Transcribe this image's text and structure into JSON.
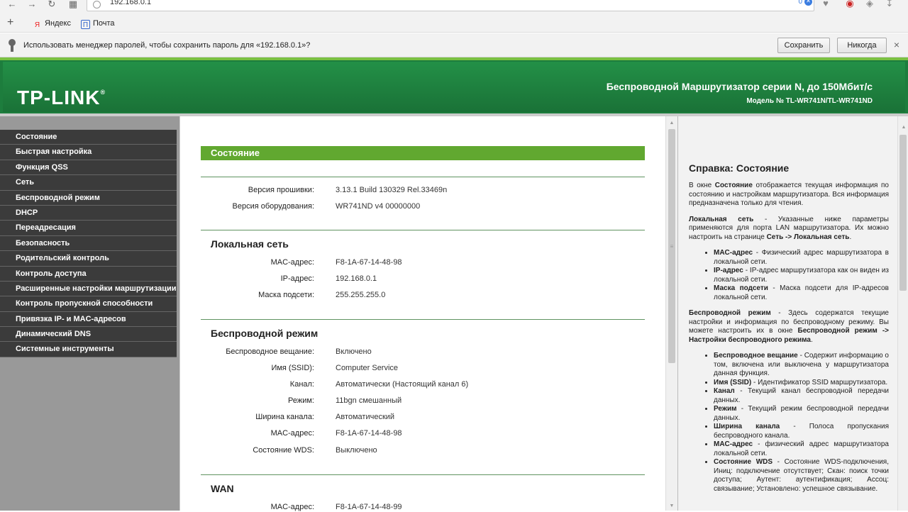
{
  "browser": {
    "url": "192.168.0.1",
    "url_counter": "0",
    "bookmarks": [
      "Яндекс",
      "Почта"
    ],
    "password_prompt": "Использовать менеджер паролей, чтобы сохранить пароль для «192.168.0.1»?",
    "save_label": "Сохранить",
    "never_label": "Никогда",
    "close_glyph": "×",
    "bookmark_icons": [
      "Я",
      "П"
    ]
  },
  "header": {
    "logo": "TP-LINK",
    "title": "Беспроводной Маршрутизатор серии N, до 150Мбит/с",
    "model": "Модель № TL-WR741N/TL-WR741ND"
  },
  "sidebar": {
    "items": [
      "Состояние",
      "Быстрая настройка",
      "Функция QSS",
      "Сеть",
      "Беспроводной режим",
      "DHCP",
      "Переадресация",
      "Безопасность",
      "Родительский контроль",
      "Контроль доступа",
      "Расширенные настройки маршрутизации",
      "Контроль пропускной способности",
      "Привязка IP- и MAC-адресов",
      "Динамический DNS",
      "Системные инструменты"
    ]
  },
  "main": {
    "section_title": "Состояние",
    "firmware_label": "Версия прошивки:",
    "firmware_value": "3.13.1 Build 130329 Rel.33469n",
    "hardware_label": "Версия оборудования:",
    "hardware_value": "WR741ND v4 00000000",
    "lan": {
      "heading": "Локальная сеть",
      "rows": [
        {
          "label": "MAC-адрес:",
          "value": "F8-1A-67-14-48-98"
        },
        {
          "label": "IP-адрес:",
          "value": "192.168.0.1"
        },
        {
          "label": "Маска подсети:",
          "value": "255.255.255.0"
        }
      ]
    },
    "wireless": {
      "heading": "Беспроводной режим",
      "rows": [
        {
          "label": "Беспроводное вещание:",
          "value": "Включено"
        },
        {
          "label": "Имя (SSID):",
          "value": "Computer Service"
        },
        {
          "label": "Канал:",
          "value": "Автоматически (Настоящий канал 6)"
        },
        {
          "label": "Режим:",
          "value": "11bgn смешанный"
        },
        {
          "label": "Ширина канала:",
          "value": "Автоматический"
        },
        {
          "label": "MAC-адрес:",
          "value": "F8-1A-67-14-48-98"
        },
        {
          "label": "Состояние WDS:",
          "value": "Выключено"
        }
      ]
    },
    "wan": {
      "heading": "WAN",
      "rows": [
        {
          "label": "MAC-адрес:",
          "value": "F8-1A-67-14-48-99"
        }
      ]
    }
  },
  "help": {
    "title": "Справка: Состояние",
    "intro_pre": "В окне ",
    "intro_bold": "Состояние",
    "intro_post": " отображается текущая информация по состоянию и настройкам маршрутизатора. Вся информация предназначена только для чтения.",
    "lan_bold": "Локальная сеть",
    "lan_text": " - Указанные ниже параметры применяются для порта LAN маршрутизатора. Их можно настроить на странице ",
    "lan_link": "Сеть -> Локальная сеть",
    "lan_end": ".",
    "lan_items": [
      {
        "bold": "MAC-адрес",
        "text": " - Физический адрес маршрутизатора в локальной сети."
      },
      {
        "bold": "IP-адрес",
        "text": " - IP-адрес маршрутизатора как он виден из локальной сети."
      },
      {
        "bold": "Маска подсети",
        "text": " - Маска подсети для IP-адресов локальной сети."
      }
    ],
    "wl_bold": "Беспроводной режим",
    "wl_text": " - Здесь содержатся текущие настройки и информация по беспроводному режиму. Вы можете настроить их в окне ",
    "wl_link": "Беспроводной режим -> Настройки беспроводного режима",
    "wl_end": ".",
    "wl_items": [
      {
        "bold": "Беспроводное вещание",
        "text": " - Содержит информацию о том, включена или выключена у маршрутизатора данная функция."
      },
      {
        "bold": "Имя (SSID)",
        "text": " - Идентификатор SSID маршрутизатора."
      },
      {
        "bold": "Канал",
        "text": " - Текущий канал беспроводной передачи данных."
      },
      {
        "bold": "Режим",
        "text": " - Текущий режим беспроводной передачи данных."
      },
      {
        "bold": "Ширина канала",
        "text": " - Полоса пропускания беспроводного канала."
      },
      {
        "bold": "MAC-адрес",
        "text": " - физический адрес маршрутизатора локальной сети."
      },
      {
        "bold": "Состояние WDS",
        "text": " - Состояние WDS-подключения, Иниц: подключение отсутствует; Скан: поиск точки доступа; Аутент: аутентификация; Ассоц: связывание; Установлено: успешное связывание."
      }
    ]
  }
}
